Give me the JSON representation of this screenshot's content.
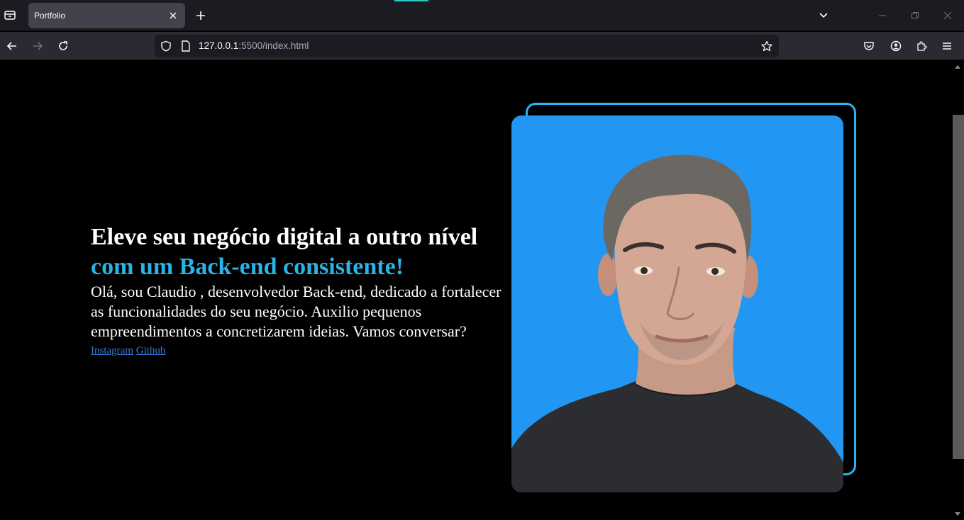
{
  "browser": {
    "tab_title": "Portfolio",
    "url_host": "127.0.0.1",
    "url_rest": ":5500/index.html",
    "icons": [
      "list-all-tabs-icon",
      "close-icon",
      "plus-icon",
      "chevron-down-icon",
      "minimize-icon",
      "restore-icon",
      "close-window-icon",
      "back-arrow-icon",
      "forward-arrow-icon",
      "reload-icon",
      "shield-icon",
      "page-icon",
      "star-icon",
      "pocket-icon",
      "account-icon",
      "extensions-icon",
      "menu-icon"
    ]
  },
  "hero": {
    "headline": "Eleve seu negócio digital a outro nível",
    "headline_accent": "com um Back-end consistente!",
    "intro": "Olá, sou Claudio , desenvolvedor Back-end, dedicado a fortalecer as funcionalidades do seu negócio. Auxilio pequenos empreendimentos a concretizarem ideias. Vamos conversar?",
    "links": [
      {
        "label": "Instagram"
      },
      {
        "label": "Github"
      }
    ]
  },
  "colors": {
    "accent": "#2ab4e6",
    "photo_bg": "#2196f3",
    "link": "#3a7bd5"
  }
}
